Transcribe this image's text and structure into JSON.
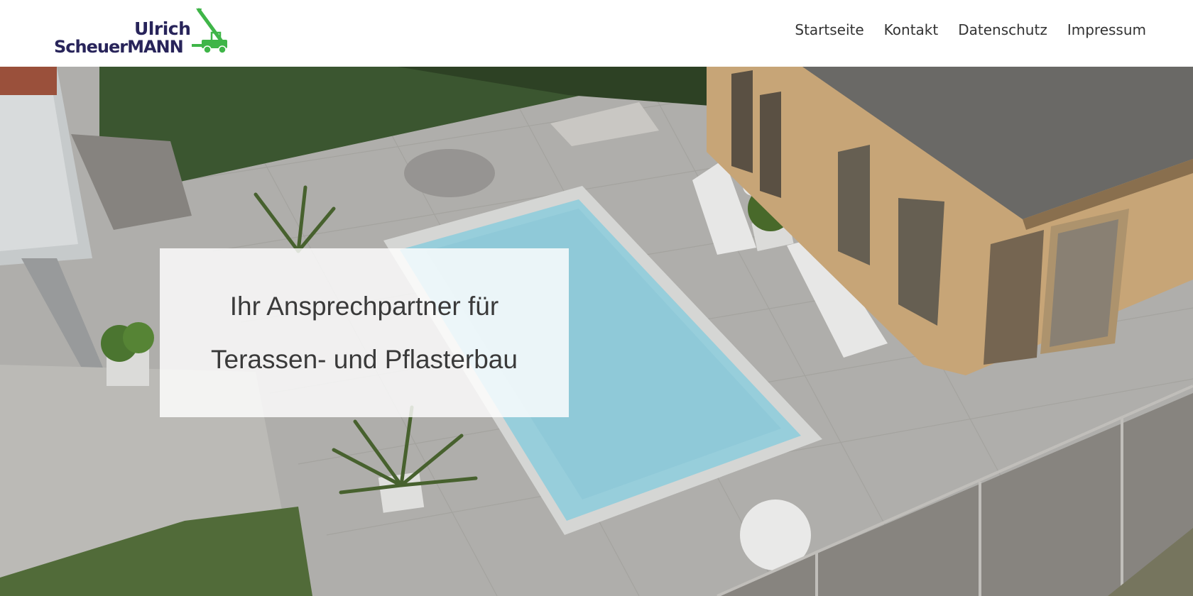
{
  "header": {
    "logo": {
      "first_name": "Ulrich",
      "last_name": "ScheuerMANN",
      "icon": "telehandler-icon",
      "colors": {
        "text": "#28245a",
        "machine": "#3fb548"
      }
    },
    "nav": [
      {
        "label": "Startseite"
      },
      {
        "label": "Kontakt"
      },
      {
        "label": "Datenschutz"
      },
      {
        "label": "Impressum"
      }
    ]
  },
  "hero": {
    "headline_line1": "Ihr Ansprechpartner für",
    "headline_line2": "Terassen- und Pflasterbau",
    "image_description_icon": "pool-terrace-photo"
  }
}
